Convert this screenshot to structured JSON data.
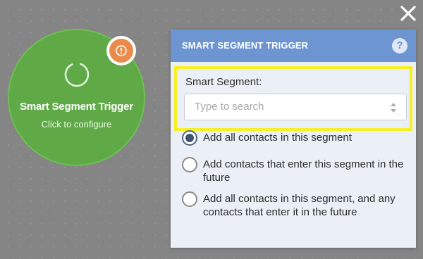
{
  "node": {
    "title": "Smart Segment Trigger",
    "subtitle": "Click to configure",
    "color": "#5faa47",
    "icon": "loading-spinner-icon",
    "badge_icon": "alert-icon",
    "badge_color": "#e98c4b"
  },
  "close": {
    "icon": "close-icon"
  },
  "panel": {
    "title": "SMART SEGMENT TRIGGER",
    "help_label": "?",
    "header_color": "#6d95d2",
    "highlight_color": "#f6f02a",
    "segment_field": {
      "label": "Smart Segment:",
      "value": "",
      "placeholder": "Type to search"
    },
    "options": [
      {
        "label": "Add all contacts in this segment",
        "checked": true
      },
      {
        "label": "Add contacts that enter this segment in the future",
        "checked": false
      },
      {
        "label": "Add all contacts in this segment, and any contacts that enter it in the future",
        "checked": false
      }
    ]
  }
}
